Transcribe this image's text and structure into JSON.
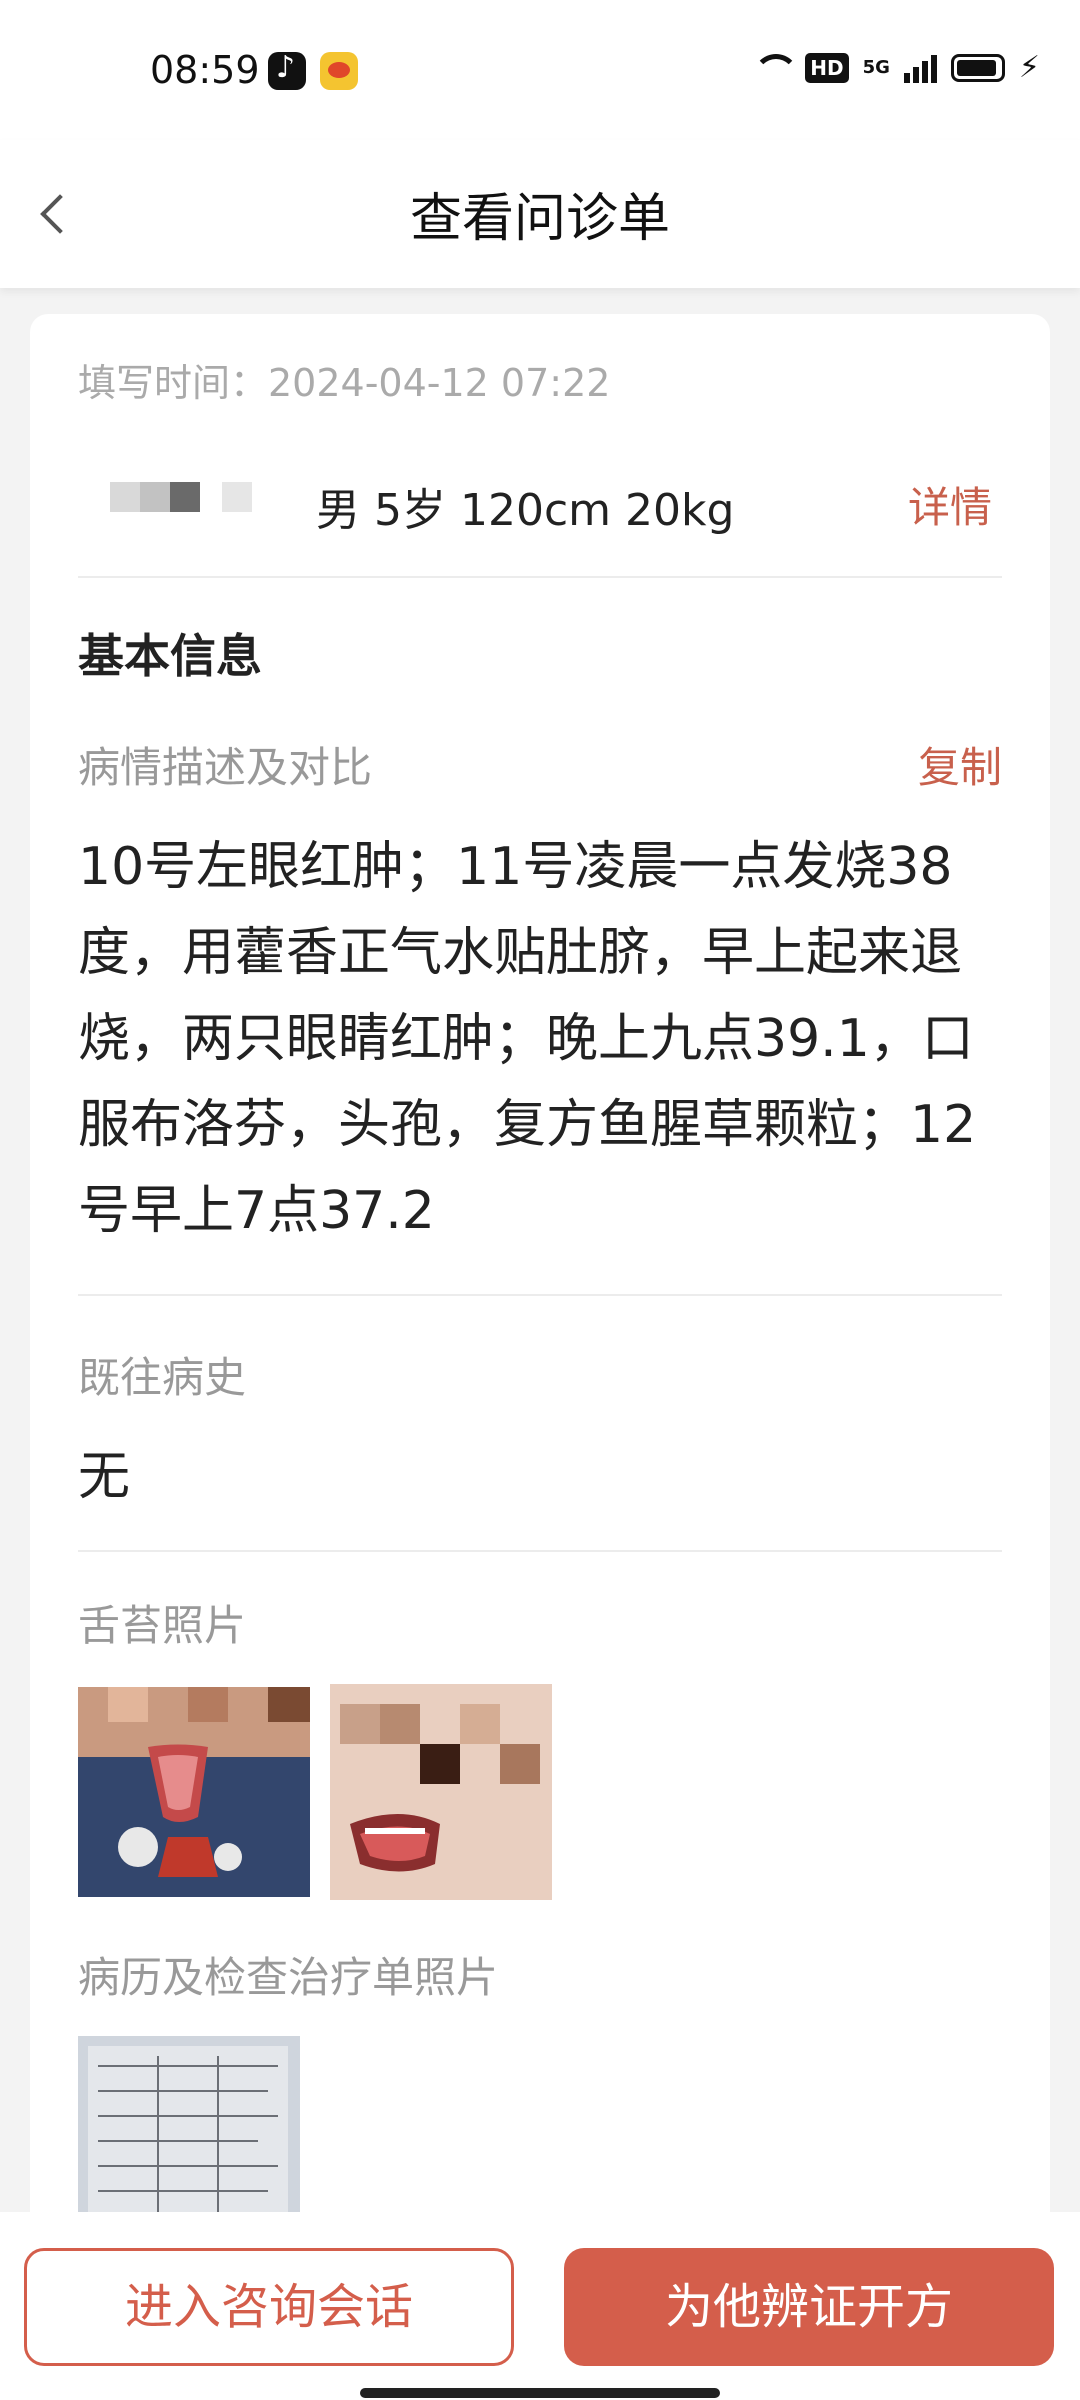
{
  "status_bar": {
    "time": "08:59",
    "icons": [
      "tiktok-icon",
      "weibo-icon",
      "wifi-icon",
      "hd-icon",
      "5g-icon",
      "signal-icon",
      "battery-icon",
      "charging-icon"
    ],
    "hd_label": "HD",
    "network_label": "5G"
  },
  "header": {
    "title": "查看问诊单",
    "back_icon": "chevron-left-icon"
  },
  "card": {
    "fill_time": "填写时间：2024-04-12 07:22",
    "patient_info": "男 5岁 120cm 20kg",
    "detail_link": "详情",
    "basic_info_title": "基本信息",
    "condition_label": "病情描述及对比",
    "copy_link": "复制",
    "condition_text": "10号左眼红肿；11号凌晨一点发烧38度，用藿香正气水贴肚脐，早上起来退烧，两只眼睛红肿；晚上九点39.1，口服布洛芬，头孢，复方鱼腥草颗粒；12号早上7点37.2",
    "history_label": "既往病史",
    "history_value": "无",
    "tongue_label": "舌苔照片",
    "records_label": "病历及检查治疗单照片"
  },
  "bottom_bar": {
    "consult_button": "进入咨询会话",
    "prescribe_button": "为他辨证开方"
  },
  "colors": {
    "accent": "#d45e4b",
    "link": "#c8604c",
    "muted_text": "#999999"
  }
}
